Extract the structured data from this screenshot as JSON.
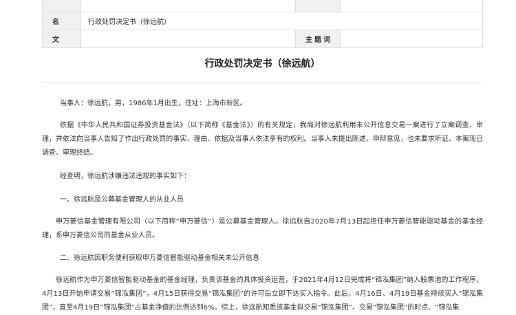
{
  "meta": {
    "name_label": "名 称",
    "name_value": "行政处罚决定书（徐远航）",
    "docno_label": "文 号",
    "docno_value": "",
    "subject_label": "主题词",
    "subject_value": ""
  },
  "document": {
    "title": "行政处罚决定书（徐远航）",
    "paragraphs": [
      "当事人：徐远航，男，1986年1月出生，住址：上海市新区。",
      "依据《中华人民共和国证券投资基金法》（以下简称《基金法》）的有关规定，我局对徐远航利用未公开信息交易一案进行了立案调查、审理，并依法向当事人告知了作出行政处罚的事实、理由、依据及当事人依法享有的权利。当事人未提出陈述、申辩意见，也未要求听证。本案现已调查、审理终结。",
      "经查明，徐远航涉嫌违法违规的事实如下：",
      "一、徐远航是公募基金管理人的从业人员",
      "申万菱信基金管理有限公司（以下简称“申万菱信”）是公募基金管理人。徐远航自2020年7月13日起担任申万菱信智能驱动基金的基金经理，系申万菱信公司的基金从业人员。",
      "二、徐远航因职务便利获取申万菱信智能驱动基金相关未公开信息",
      "徐远航作为申万菱信智能驱动基金的基金经理，负责该基金的具体投资运营，于2021年4月12日完成将“锦泓集团”纳入股票池的工作程序，4月13日开始申请交易“锦泓集团”，4月15日获得交易“锦泓集团”的许可后立即下达买入指令。此后，4月16日、4月19日基金持续买入“锦泓集团”，直至4月19日“锦泓集团”占基金净值的比例达到6%。综上，徐远航知悉该基金拟交易“锦泓集团”、交易“锦泓集团”的时点、“锦泓集"
    ]
  }
}
